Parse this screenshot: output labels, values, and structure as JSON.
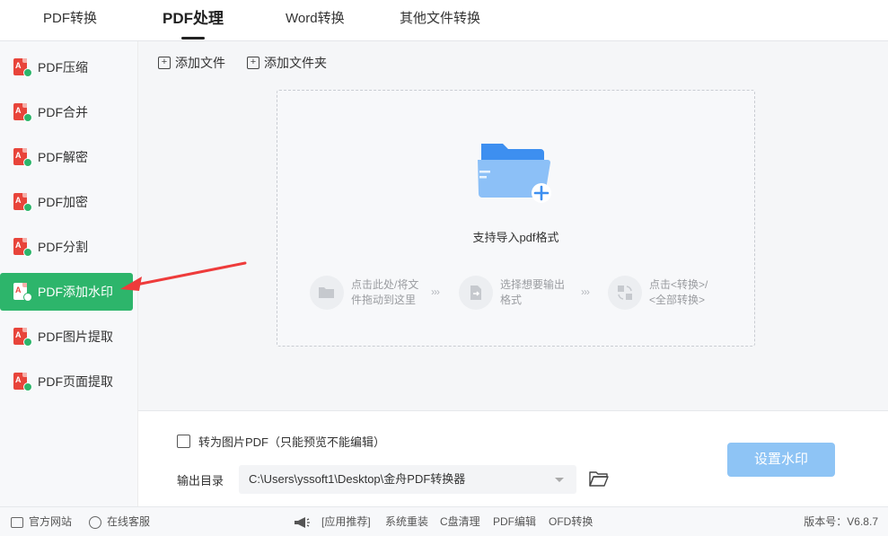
{
  "top_tabs": [
    {
      "label": "PDF转换"
    },
    {
      "label": "PDF处理"
    },
    {
      "label": "Word转换"
    },
    {
      "label": "其他文件转换"
    }
  ],
  "sidebar": {
    "items": [
      {
        "label": "PDF压缩"
      },
      {
        "label": "PDF合并"
      },
      {
        "label": "PDF解密"
      },
      {
        "label": "PDF加密"
      },
      {
        "label": "PDF分割"
      },
      {
        "label": "PDF添加水印"
      },
      {
        "label": "PDF图片提取"
      },
      {
        "label": "PDF页面提取"
      }
    ]
  },
  "toolbar": {
    "add_file": "添加文件",
    "add_folder": "添加文件夹"
  },
  "dropzone": {
    "support_text": "支持导入pdf格式",
    "steps": [
      {
        "line1": "点击此处/将文",
        "line2": "件拖动到这里"
      },
      {
        "line1": "选择想要输出",
        "line2": "格式"
      },
      {
        "line1": "点击<转换>/",
        "line2": "<全部转换>"
      }
    ],
    "step_arrow": "›››"
  },
  "settings": {
    "to_image_pdf_label": "转为图片PDF（只能预览不能编辑）",
    "output_dir_label": "输出目录",
    "output_dir_value": "C:\\Users\\yssoft1\\Desktop\\金舟PDF转换器",
    "action_button": "设置水印"
  },
  "statusbar": {
    "website": "官方网站",
    "support": "在线客服",
    "promo_prefix": "[应用推荐]",
    "promo_links": [
      "系统重装",
      "C盘清理",
      "PDF编辑",
      "OFD转换"
    ],
    "version": "版本号：V6.8.7"
  },
  "colors": {
    "accent_green": "#2db56b",
    "pdf_red": "#e8443a",
    "button_blue": "#8ec4f5",
    "folder_blue": "#3d8ff0",
    "annotation_red": "#ee3b3b"
  }
}
